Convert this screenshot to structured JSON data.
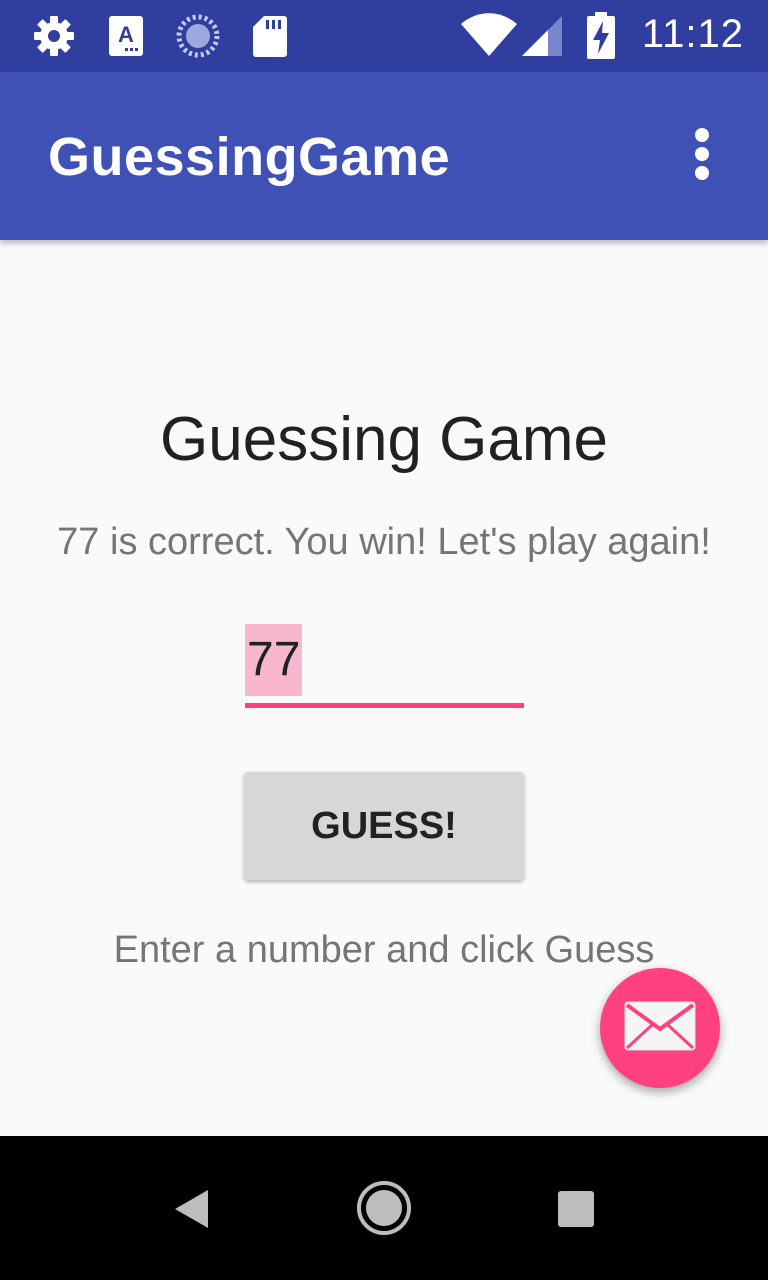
{
  "status_bar": {
    "icons": [
      "settings-icon",
      "font-accessibility-icon",
      "sync-progress-icon",
      "sd-card-icon",
      "wifi-icon",
      "cell-signal-icon",
      "battery-charging-icon"
    ],
    "time": "11:12",
    "color": "#303f9f"
  },
  "app_bar": {
    "title": "GuessingGame",
    "menu_icon": "overflow-menu-icon",
    "color": "#3f51b5"
  },
  "main": {
    "title": "Guessing Game",
    "result_message": "77 is correct. You win! Let's play again!",
    "guess_input": {
      "value": "77",
      "accent": "#ff4081"
    },
    "guess_button_label": "GUESS!",
    "hint": "Enter a number and click Guess"
  },
  "fab": {
    "icon": "mail-icon",
    "color": "#ff4081"
  },
  "nav_bar": {
    "buttons": [
      "back-icon",
      "home-icon",
      "recents-icon"
    ]
  }
}
